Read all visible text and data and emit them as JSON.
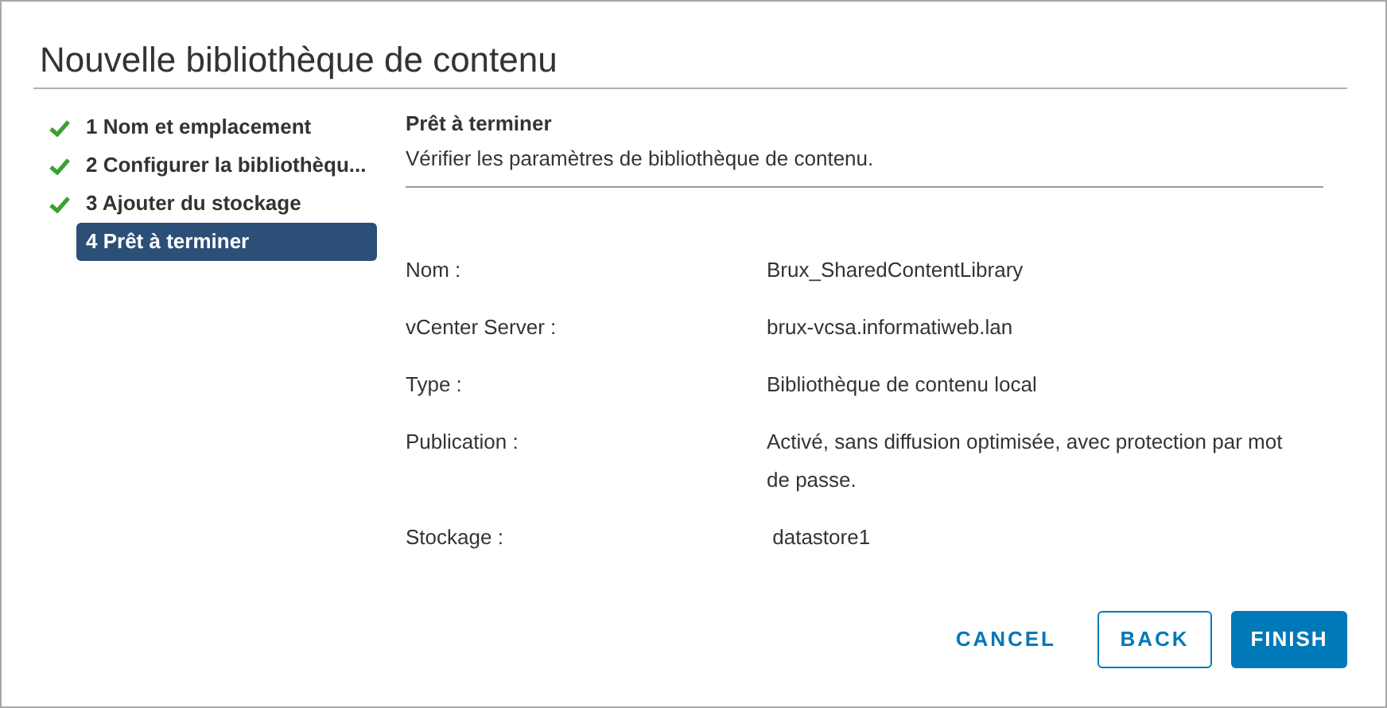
{
  "window": {
    "title": "Nouvelle bibliothèque de contenu"
  },
  "steps": [
    {
      "label": "1 Nom et emplacement",
      "completed": true,
      "selected": false
    },
    {
      "label": "2 Configurer la bibliothèqu...",
      "completed": true,
      "selected": false
    },
    {
      "label": "3 Ajouter du stockage",
      "completed": true,
      "selected": false
    },
    {
      "label": "4 Prêt à terminer",
      "completed": false,
      "selected": true
    }
  ],
  "section": {
    "title": "Prêt à terminer",
    "subtitle": "Vérifier les paramètres de bibliothèque de contenu."
  },
  "fields": [
    {
      "label": "Nom :",
      "value": "Brux_SharedContentLibrary"
    },
    {
      "label": "vCenter Server :",
      "value": "brux-vcsa.informatiweb.lan"
    },
    {
      "label": "Type :",
      "value": "Bibliothèque de contenu local"
    },
    {
      "label": "Publication :",
      "value": "Activé, sans diffusion optimisée, avec protection par mot de passe."
    },
    {
      "label": "Stockage :",
      "value": " datastore1"
    }
  ],
  "buttons": [
    {
      "label": "CANCEL",
      "kind": "link"
    },
    {
      "label": "BACK",
      "kind": "outline"
    },
    {
      "label": "FINISH",
      "kind": "primary"
    }
  ]
}
